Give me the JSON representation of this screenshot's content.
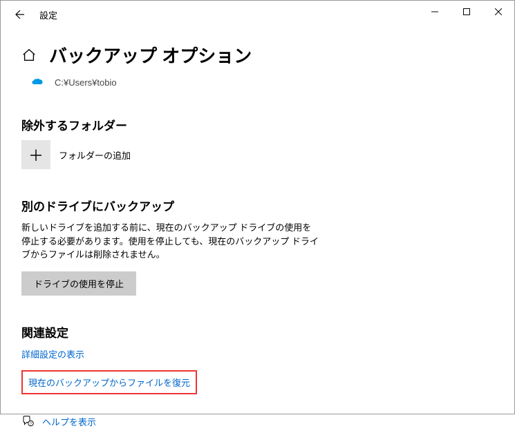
{
  "titlebar": {
    "title": "設定"
  },
  "header": {
    "page_title": "バックアップ オプション",
    "path": "C:¥Users¥tobio"
  },
  "sections": {
    "exclude": {
      "title": "除外するフォルダー",
      "add_label": "フォルダーの追加"
    },
    "another_drive": {
      "title": "別のドライブにバックアップ",
      "description": "新しいドライブを追加する前に、現在のバックアップ ドライブの使用を停止する必要があります。使用を停止しても、現在のバックアップ ドライブからファイルは削除されません。",
      "button": "ドライブの使用を停止"
    },
    "related": {
      "title": "関連設定",
      "advanced_link": "詳細設定の表示",
      "restore_link": "現在のバックアップからファイルを復元"
    }
  },
  "help": {
    "label": "ヘルプを表示"
  }
}
